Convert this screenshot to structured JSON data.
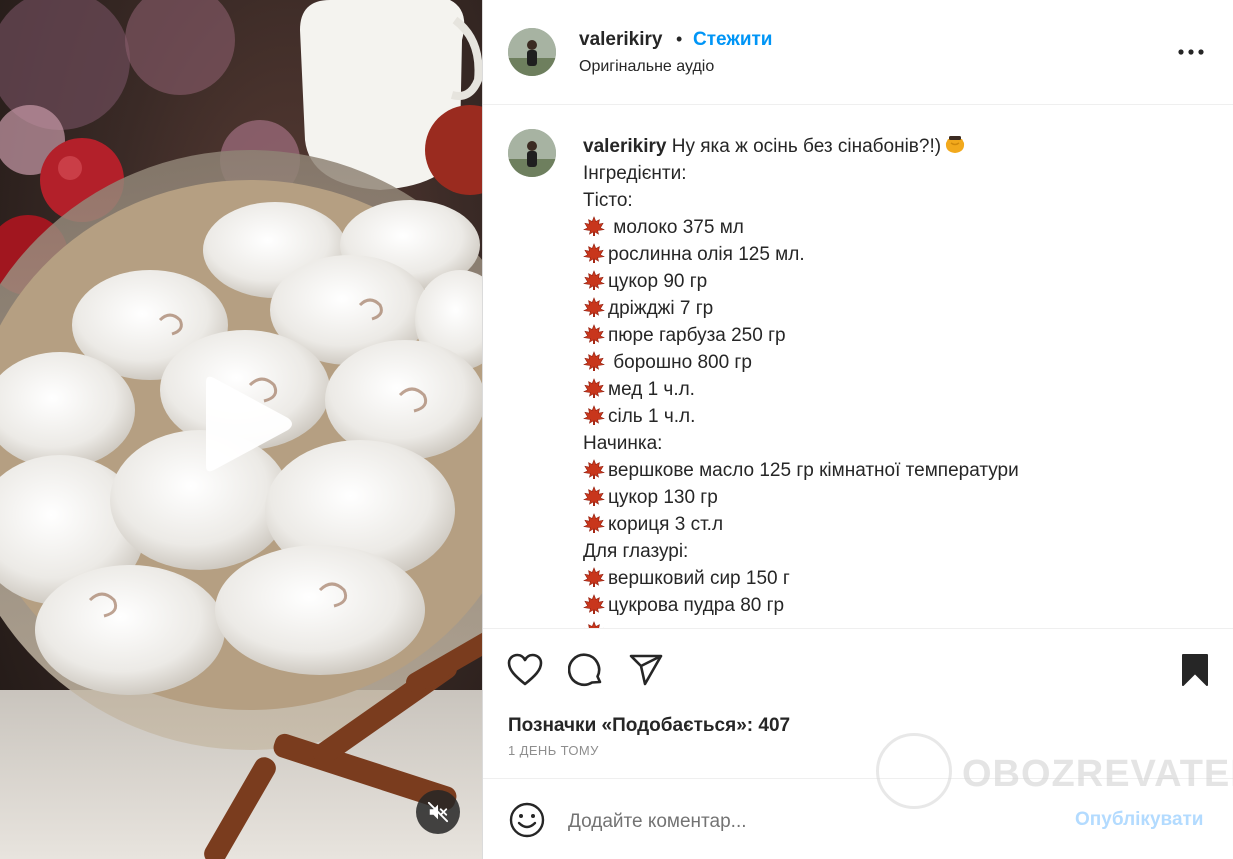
{
  "header": {
    "username": "valerikiry",
    "separator": "•",
    "follow_label": "Стежити",
    "audio_label": "Оригінальне аудіо"
  },
  "caption": {
    "username": "valerikiry",
    "title": " Ну яка ж осінь без сінабонів?!)",
    "lines": [
      {
        "leaf": false,
        "text": "Інгредієнти:"
      },
      {
        "leaf": false,
        "text": "Тісто:"
      },
      {
        "leaf": true,
        "text": " молоко 375 мл"
      },
      {
        "leaf": true,
        "text": "рослинна олія 125 мл."
      },
      {
        "leaf": true,
        "text": "цукор 90 гр"
      },
      {
        "leaf": true,
        "text": "дріжджі 7 гр"
      },
      {
        "leaf": true,
        "text": "пюре гарбуза 250 гр"
      },
      {
        "leaf": true,
        "text": " борошно 800 гр"
      },
      {
        "leaf": true,
        "text": "мед 1 ч.л."
      },
      {
        "leaf": true,
        "text": "сіль 1 ч.л."
      },
      {
        "leaf": false,
        "text": "Начинка:"
      },
      {
        "leaf": true,
        "text": "вершкове масло 125 гр кімнатної температури"
      },
      {
        "leaf": true,
        "text": "цукор 130 гр"
      },
      {
        "leaf": true,
        "text": "кориця 3 ст.л"
      },
      {
        "leaf": false,
        "text": "Для глазурі:"
      },
      {
        "leaf": true,
        "text": "вершковий сир 150 г"
      },
      {
        "leaf": true,
        "text": "цукрова пудра 80 гр"
      },
      {
        "leaf": true,
        "text": ""
      }
    ]
  },
  "engagement": {
    "likes_label": "Позначки «Подобається»: 407",
    "date_label": "1 ДЕНЬ ТОМУ"
  },
  "comment": {
    "placeholder": "Додайте коментар...",
    "publish_label": "Опублікувати"
  },
  "watermark": {
    "text": "OBOZREVATEL"
  },
  "icons": {
    "like": "heart-icon",
    "comment": "comment-bubble-icon",
    "share": "paper-plane-icon",
    "save": "bookmark-filled-icon",
    "more": "more-horizontal-icon",
    "emoji": "smiley-icon",
    "play": "play-icon",
    "mute": "speaker-muted-icon",
    "bullet": "maple-leaf-icon",
    "title_emoji": "honey-pot-icon"
  },
  "colors": {
    "accent": "#0095f6",
    "publish_disabled": "#b3dbff",
    "text": "#262626",
    "muted": "#8e8e8e"
  }
}
